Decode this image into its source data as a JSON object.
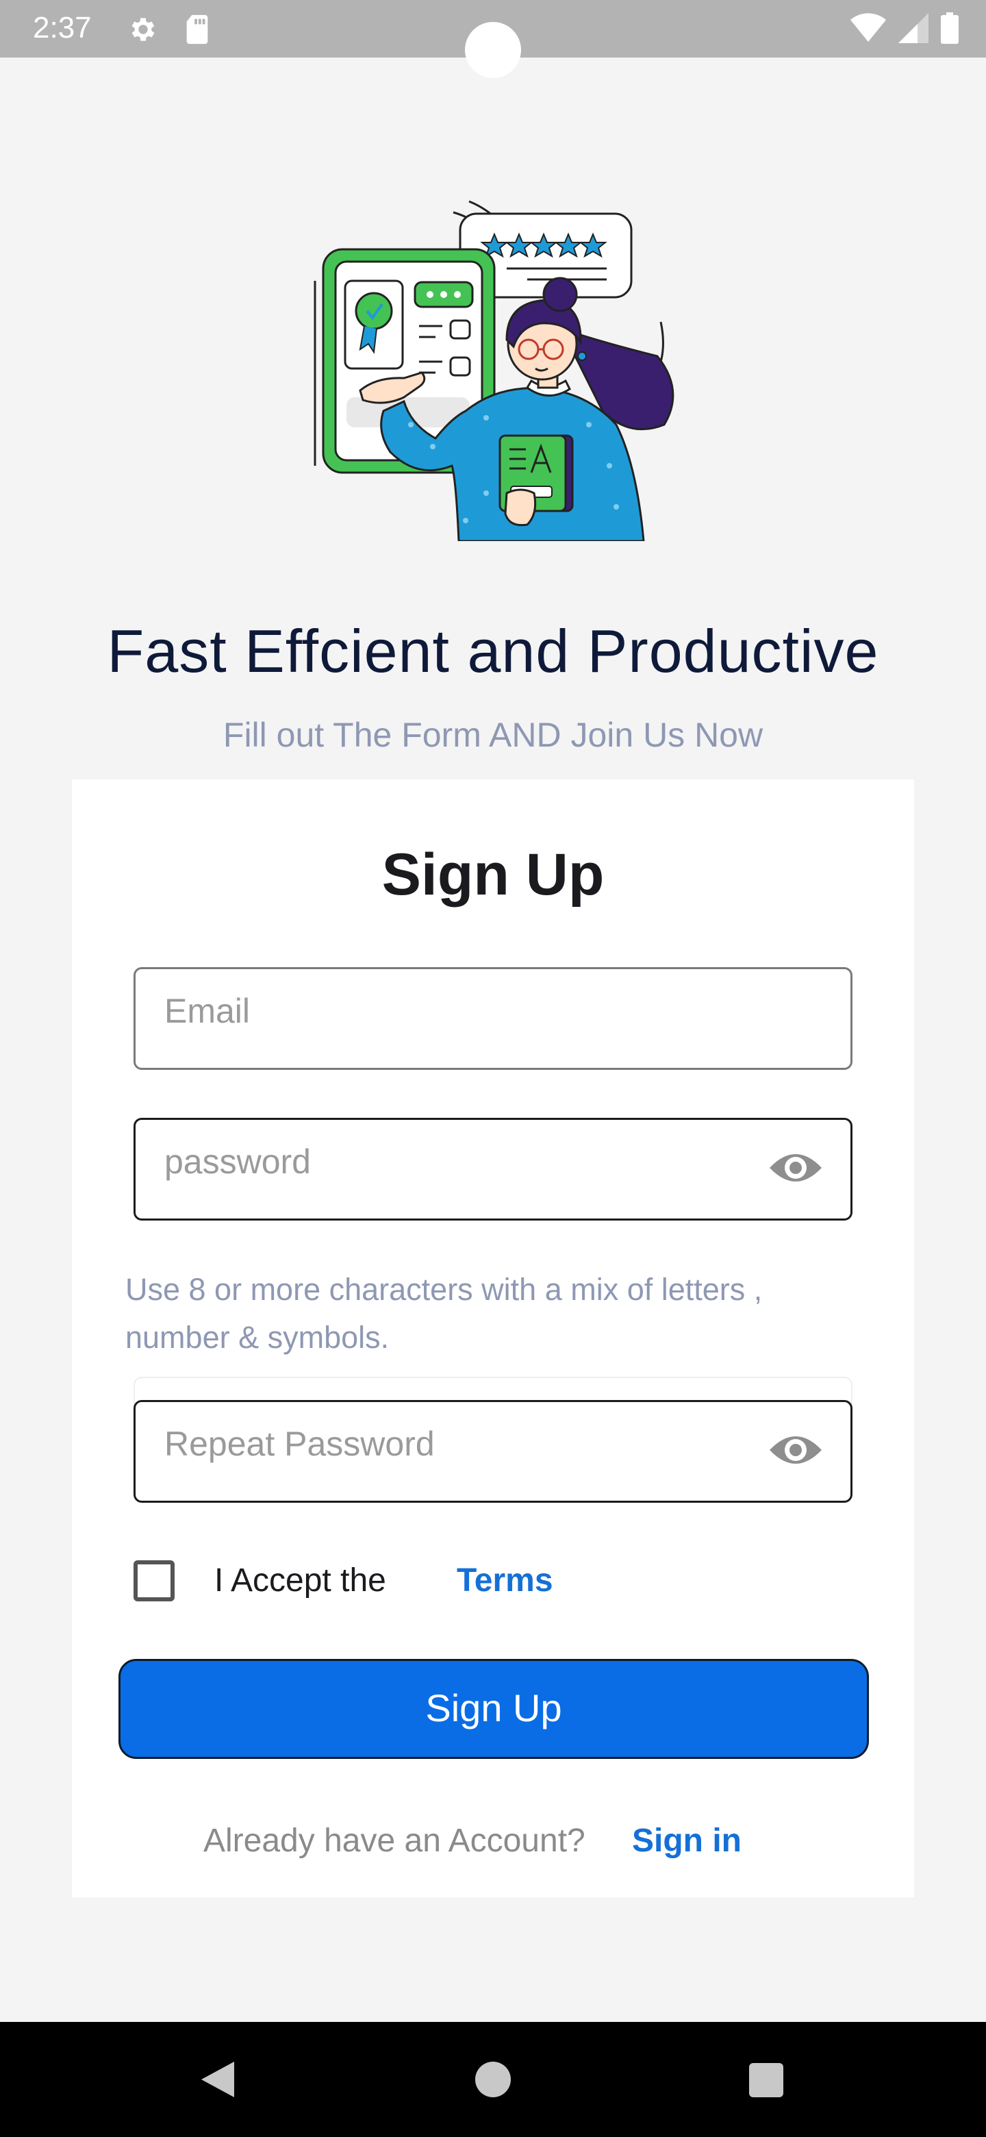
{
  "status_bar": {
    "time": "2:37",
    "icons": [
      "gear-icon",
      "sd-card-icon",
      "wifi-icon",
      "signal-icon",
      "battery-icon"
    ]
  },
  "hero": {
    "illustration": "woman-with-phone-and-review-illustration"
  },
  "headline": "Fast Effcient and Productive",
  "subheadline": "Fill out The Form AND Join Us Now",
  "form": {
    "title": "Sign Up",
    "email_placeholder": "Email",
    "password_placeholder": "password",
    "password_hint": "Use 8 or more characters with a mix of letters , number & symbols.",
    "repeat_password_placeholder": "Repeat Password",
    "accept_label": "I Accept the",
    "terms_link": "Terms",
    "terms_checked": false,
    "submit_label": "Sign Up",
    "already_account_text": "Already have an Account?",
    "signin_link": "Sign in"
  },
  "colors": {
    "accent": "#0a6de6",
    "link": "#1570d6",
    "headline": "#0f1a3a",
    "muted": "#8e98b3"
  },
  "nav_bar": {
    "icons": [
      "back-icon",
      "home-icon",
      "recents-icon"
    ]
  }
}
